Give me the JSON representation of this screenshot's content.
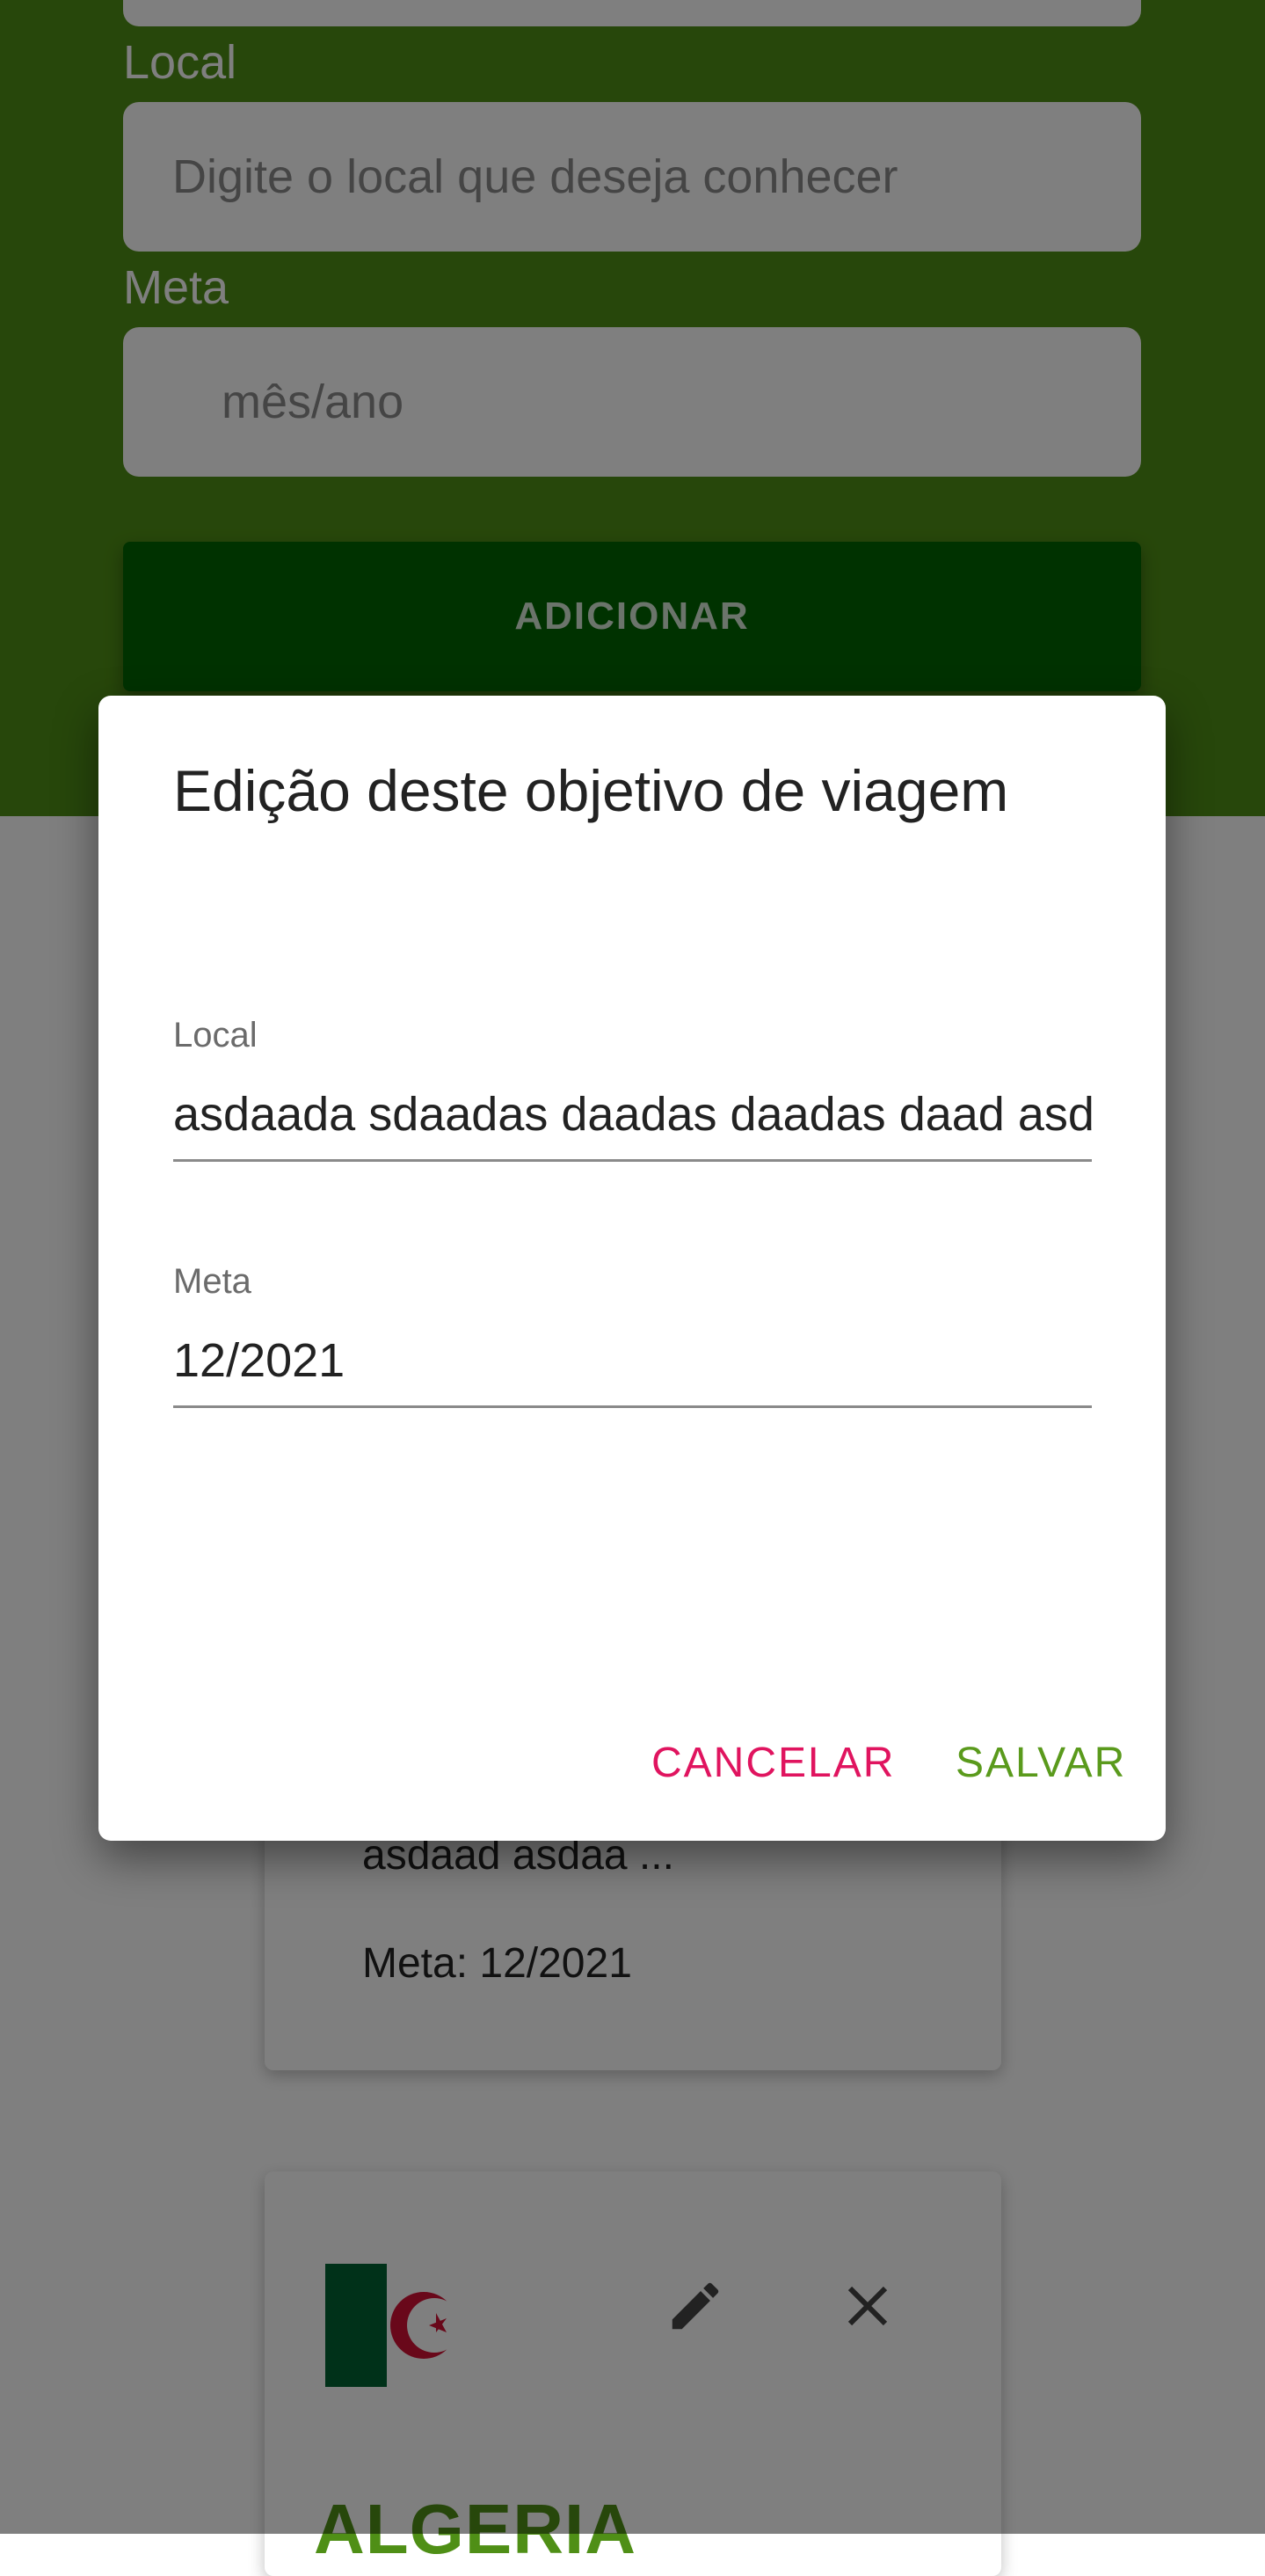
{
  "form": {
    "local_label": "Local",
    "local_placeholder": "Digite o local que deseja conhecer",
    "meta_label": "Meta",
    "meta_placeholder": "mês/ano",
    "add_button": "ADICIONAR"
  },
  "cards": [
    {
      "text_fragment": "asdaad asdaa ...",
      "meta": "Meta: 12/2021"
    },
    {
      "country": "ALGERIA"
    }
  ],
  "dialog": {
    "title": "Edição deste objetivo de viagem",
    "local_label": "Local",
    "local_value": "asdaada sdaadas daadas daadas daad asdaad asdaa",
    "meta_label": "Meta",
    "meta_value": "12/2021",
    "cancel": "CANCELAR",
    "save": "SALVAR"
  },
  "colors": {
    "brand_green": "#4f8f16",
    "button_dark_green": "#006400",
    "cancel_pink": "#e0145f",
    "save_green": "#5a9a1c"
  },
  "icons": [
    "edit-icon",
    "close-icon",
    "algeria-flag"
  ]
}
